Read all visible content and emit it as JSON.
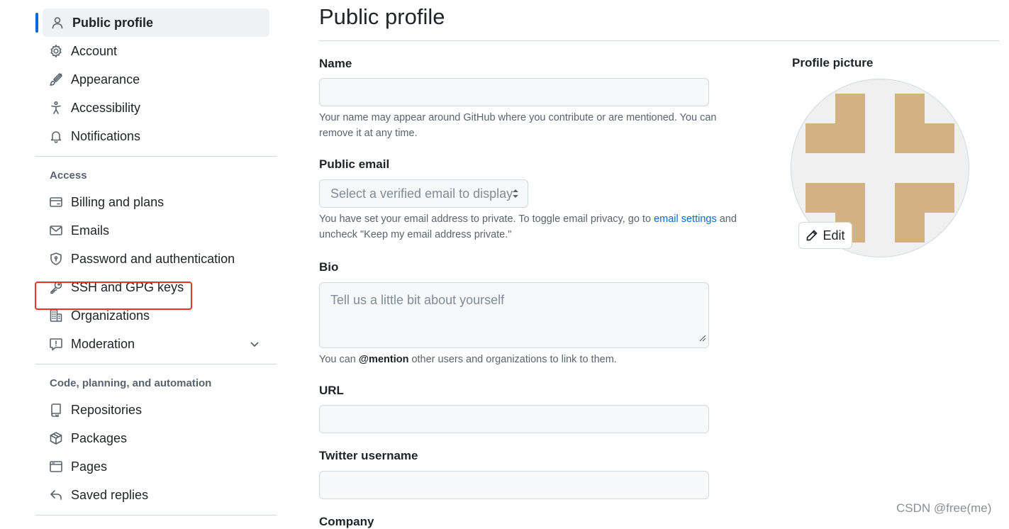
{
  "sidebar": {
    "items_top": [
      {
        "label": "Public profile",
        "icon": "person-icon"
      },
      {
        "label": "Account",
        "icon": "gear-icon"
      },
      {
        "label": "Appearance",
        "icon": "paintbrush-icon"
      },
      {
        "label": "Accessibility",
        "icon": "accessibility-icon"
      },
      {
        "label": "Notifications",
        "icon": "bell-icon"
      }
    ],
    "access_heading": "Access",
    "items_access": [
      {
        "label": "Billing and plans",
        "icon": "credit-card-icon"
      },
      {
        "label": "Emails",
        "icon": "mail-icon"
      },
      {
        "label": "Password and authentication",
        "icon": "shield-icon"
      },
      {
        "label": "SSH and GPG keys",
        "icon": "key-icon"
      },
      {
        "label": "Organizations",
        "icon": "organization-icon"
      },
      {
        "label": "Moderation",
        "icon": "report-icon"
      }
    ],
    "code_heading": "Code, planning, and automation",
    "items_code": [
      {
        "label": "Repositories",
        "icon": "repo-icon"
      },
      {
        "label": "Packages",
        "icon": "package-icon"
      },
      {
        "label": "Pages",
        "icon": "browser-icon"
      },
      {
        "label": "Saved replies",
        "icon": "reply-icon"
      }
    ]
  },
  "main": {
    "title": "Public profile",
    "name": {
      "label": "Name",
      "value": "",
      "note": "Your name may appear around GitHub where you contribute or are mentioned. You can remove it at any time."
    },
    "public_email": {
      "label": "Public email",
      "selected": "Select a verified email to display",
      "note_before": "You have set your email address to private. To toggle email privacy, go to ",
      "note_link": "email settings",
      "note_after": " and uncheck \"Keep my email address private.\""
    },
    "bio": {
      "label": "Bio",
      "placeholder": "Tell us a little bit about yourself",
      "note_before": "You can ",
      "note_bold": "@mention",
      "note_after": " other users and organizations to link to them."
    },
    "url": {
      "label": "URL",
      "value": ""
    },
    "twitter": {
      "label": "Twitter username",
      "value": ""
    },
    "company": {
      "label": "Company"
    }
  },
  "profile_picture": {
    "label": "Profile picture",
    "edit_label": "Edit",
    "identicon_color": "#d4b181"
  },
  "watermark": "CSDN @free(me)",
  "colors": {
    "accent": "#0969da",
    "highlight": "#e8332a"
  }
}
